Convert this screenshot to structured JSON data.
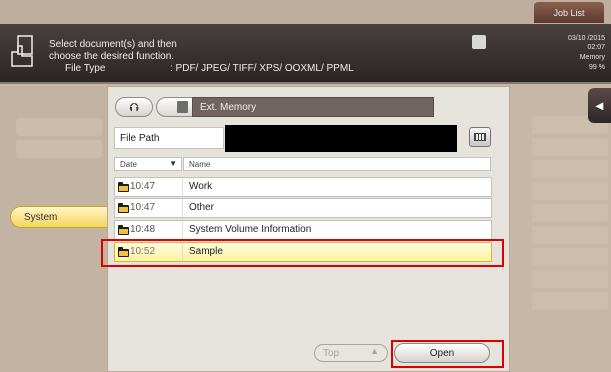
{
  "top_bar": {
    "job_list_label": "Job List"
  },
  "header": {
    "line1": "Select document(s) and then",
    "line2": "choose the desired function.",
    "file_type_label": "File Type",
    "file_type_value": ": PDF/ JPEG/ TIFF/ XPS/ OOXML/ PPML"
  },
  "status": {
    "date": "03/10 /2015",
    "time": "02:07",
    "memory_label": "Memory",
    "memory_percent": "99 %"
  },
  "left_nav": {
    "system_label": "System"
  },
  "browser": {
    "location": "Ext. Memory",
    "file_path_label": "File Path",
    "columns": {
      "date": "Date",
      "name": "Name"
    },
    "rows": [
      {
        "time": "10:47",
        "name": "Work"
      },
      {
        "time": "10:47",
        "name": "Other"
      },
      {
        "time": "10:48",
        "name": "System Volume Information"
      },
      {
        "time": "10:52",
        "name": "Sample",
        "selected": true
      }
    ],
    "top_label": "Top",
    "open_label": "Open"
  }
}
